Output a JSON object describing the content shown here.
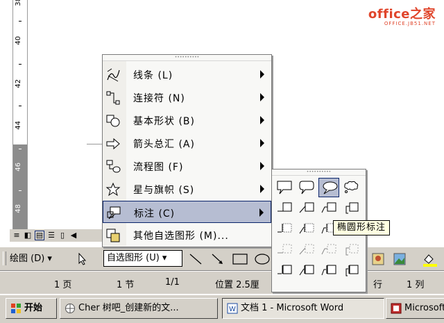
{
  "logo": {
    "brand": "office之家",
    "sub": "OFFICE.JB51.NET"
  },
  "ruler": {
    "labels": [
      "38",
      "40",
      "42",
      "44",
      "46",
      "48"
    ]
  },
  "menu": {
    "items": [
      {
        "label": "线条 (L)",
        "icon": "lines-icon",
        "submenu": true
      },
      {
        "label": "连接符 (N)",
        "icon": "connector-icon",
        "submenu": true
      },
      {
        "label": "基本形状 (B)",
        "icon": "basic-shapes-icon",
        "submenu": true
      },
      {
        "label": "箭头总汇 (A)",
        "icon": "block-arrows-icon",
        "submenu": true
      },
      {
        "label": "流程图 (F)",
        "icon": "flowchart-icon",
        "submenu": true
      },
      {
        "label": "星与旗帜 (S)",
        "icon": "stars-banners-icon",
        "submenu": true
      },
      {
        "label": "标注 (C)",
        "icon": "callouts-icon",
        "submenu": true,
        "highlighted": true
      },
      {
        "label": "其他自选图形 (M)...",
        "icon": "more-shapes-icon",
        "submenu": false
      }
    ]
  },
  "tooltip": {
    "text": "椭圆形标注"
  },
  "toolbar": {
    "draw_label": "绘图 (D)",
    "autoshapes_label": "自选图形 (U)"
  },
  "status": {
    "page": "1 页",
    "section": "1 节",
    "pages": "1/1",
    "position": "位置 2.5厘",
    "line": "行",
    "column": "1 列"
  },
  "taskbar": {
    "start": "开始",
    "tasks": [
      {
        "label": "Cher 树吧_创建新的文...",
        "icon": "browser-icon"
      },
      {
        "label": "文档 1 - Microsoft Word",
        "icon": "word-icon",
        "active": true
      },
      {
        "label": "Microsoft",
        "icon": "app-icon"
      }
    ]
  },
  "colors": {
    "accent_highlight": "#b6bdd2",
    "highlight_border": "#0a246a",
    "tooltip_bg": "#ffffe1",
    "logo": "#e0452b"
  }
}
